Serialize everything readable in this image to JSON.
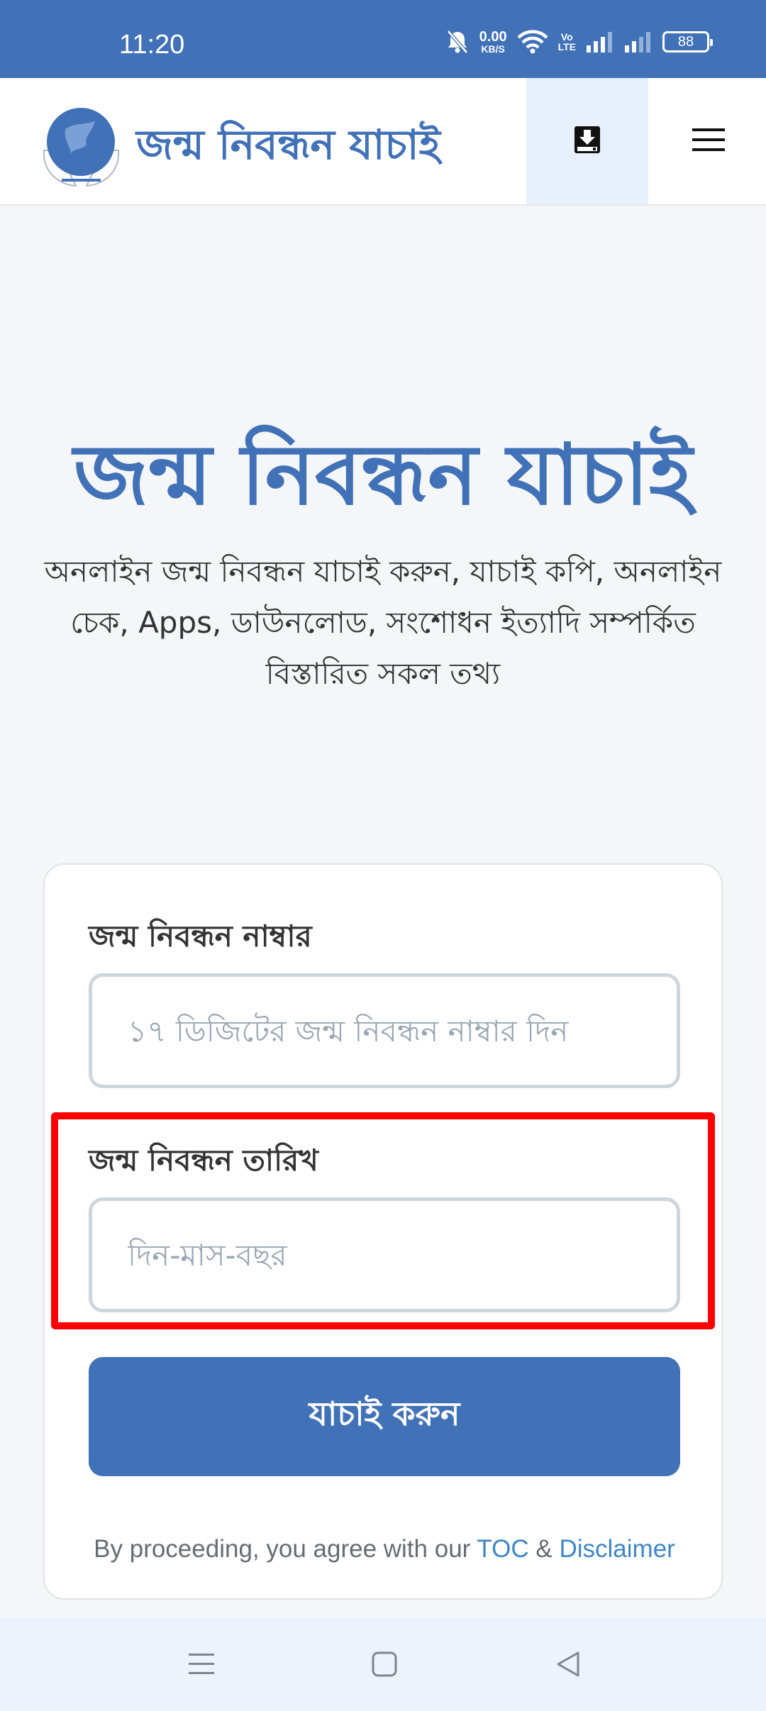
{
  "status_bar": {
    "time": "11:20",
    "net_speed_value": "0.00",
    "net_speed_unit": "KB/S",
    "volte_top": "Vo",
    "volte_bottom": "LTE",
    "battery": "88",
    "icons": [
      "mute-bell-icon",
      "wifi-icon",
      "volte-icon",
      "signal-icon",
      "signal-icon",
      "battery-icon"
    ]
  },
  "header": {
    "brand": "জন্ম নিবন্ধন যাচাই",
    "logo": "globe-hands-logo",
    "download_icon": "download-icon",
    "menu_icon": "hamburger-menu-icon"
  },
  "hero": {
    "title": "জন্ম নিবন্ধন যাচাই",
    "subtitle": "অনলাইন জন্ম নিবন্ধন যাচাই করুন, যাচাই কপি, অনলাইন চেক, Apps, ডাউনলোড, সংশোধন ইত্যাদি সম্পর্কিত বিস্তারিত সকল তথ্য"
  },
  "form": {
    "reg_number_label": "জন্ম নিবন্ধন নাম্বার",
    "reg_number_placeholder": "১৭ ডিজিটের জন্ম নিবন্ধন নাম্বার দিন",
    "reg_date_label": "জন্ম নিবন্ধন তারিখ",
    "reg_date_placeholder": "দিন-মাস-বছর",
    "submit_label": "যাচাই করুন",
    "terms_prefix": "By proceeding, you agree with our",
    "terms_toc": "TOC",
    "terms_amp": "&",
    "terms_disclaimer": "Disclaimer"
  },
  "colors": {
    "primary": "#4171b7",
    "link": "#3f86c6",
    "highlight": "#ff0000"
  },
  "nav": {
    "icons": [
      "recent-apps-icon",
      "home-icon",
      "back-icon"
    ]
  }
}
